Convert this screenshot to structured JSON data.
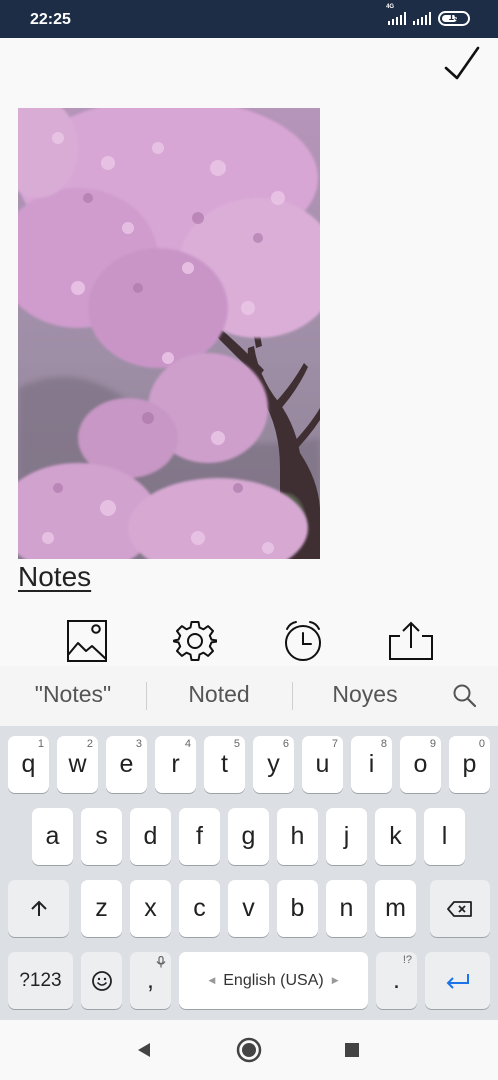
{
  "status": {
    "time": "22:25",
    "network": "4G",
    "battery": "19"
  },
  "note": {
    "text": "Notes"
  },
  "suggestions": [
    "\"Notes\"",
    "Noted",
    "Noyes"
  ],
  "keyboard": {
    "row1": [
      {
        "label": "q",
        "hint": "1"
      },
      {
        "label": "w",
        "hint": "2"
      },
      {
        "label": "e",
        "hint": "3"
      },
      {
        "label": "r",
        "hint": "4"
      },
      {
        "label": "t",
        "hint": "5"
      },
      {
        "label": "y",
        "hint": "6"
      },
      {
        "label": "u",
        "hint": "7"
      },
      {
        "label": "i",
        "hint": "8"
      },
      {
        "label": "o",
        "hint": "9"
      },
      {
        "label": "p",
        "hint": "0"
      }
    ],
    "row2": [
      "a",
      "s",
      "d",
      "f",
      "g",
      "h",
      "j",
      "k",
      "l"
    ],
    "row3": [
      "z",
      "x",
      "c",
      "v",
      "b",
      "n",
      "m"
    ],
    "symbols_label": "?123",
    "comma": ",",
    "space_label": "English (USA)",
    "period": ".",
    "period_hint": "!?"
  },
  "colors": {
    "status_bar": "#1d2d45",
    "accent": "#1a73e8",
    "keyboard_bg": "#dcdfe3"
  }
}
